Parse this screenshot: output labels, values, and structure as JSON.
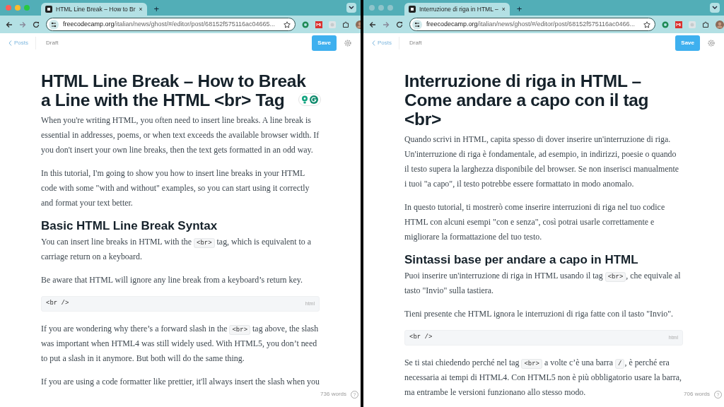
{
  "windows": [
    {
      "active": true,
      "tab": {
        "title": "HTML Line Break – How to Br",
        "close": "×"
      },
      "new_tab": "+",
      "url": {
        "host": "freecodecamp.org",
        "path": "/italian/news/ghost/#/editor/post/68152f575116ac04665..."
      },
      "editor": {
        "back_link": "Posts",
        "status": "Draft",
        "save": "Save",
        "title": "HTML Line Break – How to Break a Line with the HTML <br> Tag",
        "assistant_badge": true,
        "blocks": [
          {
            "kind": "paragraph",
            "parts": [
              {
                "kind": "text",
                "text": "When you're writing HTML, you often need to insert line breaks. A line break is essential in addresses, poems, or when text exceeds the available browser width. If you don't insert your own line breaks, then the text gets formatted in an odd way."
              }
            ]
          },
          {
            "kind": "paragraph",
            "parts": [
              {
                "kind": "text",
                "text": "In this tutorial, I'm going to show you how to insert line breaks in your HTML code with some \"with and without\" examples, so you can start using it correctly and format your text better."
              }
            ]
          },
          {
            "kind": "heading",
            "text": "Basic HTML Line Break Syntax"
          },
          {
            "kind": "paragraph",
            "parts": [
              {
                "kind": "text",
                "text": "You can insert line breaks in HTML with the "
              },
              {
                "kind": "code",
                "text": "<br>"
              },
              {
                "kind": "text",
                "text": " tag, which is equivalent to a carriage return on a keyboard."
              }
            ]
          },
          {
            "kind": "paragraph",
            "parts": [
              {
                "kind": "text",
                "text": "Be aware that HTML will ignore any line break from a keyboard’s return key."
              }
            ]
          },
          {
            "kind": "code_block",
            "code": "<br />",
            "language": "html"
          },
          {
            "kind": "paragraph",
            "parts": [
              {
                "kind": "text",
                "text": "If you are wondering why there’s a forward slash in the "
              },
              {
                "kind": "code",
                "text": "<br>"
              },
              {
                "kind": "text",
                "text": " tag above, the slash was important when HTML4 was still widely used. With HTML5, you don’t need to put a slash in it anymore. But both will do the same thing."
              }
            ]
          },
          {
            "kind": "paragraph",
            "parts": [
              {
                "kind": "text",
                "text": "If you are using a code formatter like prettier, it'll always insert the slash when you"
              }
            ]
          }
        ],
        "word_count": "736 words",
        "help": "?"
      }
    },
    {
      "active": false,
      "tab": {
        "title": "Interruzione di riga in HTML –",
        "close": "×"
      },
      "new_tab": "+",
      "url": {
        "host": "freecodecamp.org",
        "path": "/italian/news/ghost/#/editor/post/68152f575116ac0466..."
      },
      "editor": {
        "back_link": "Posts",
        "status": "Draft",
        "save": "Save",
        "title": "Interruzione di riga in HTML – Come andare a capo con il tag <br>",
        "assistant_badge": false,
        "blocks": [
          {
            "kind": "paragraph",
            "parts": [
              {
                "kind": "text",
                "text": "Quando scrivi in HTML, capita spesso di dover inserire un'interruzione di riga. Un'interruzione di riga è fondamentale, ad esempio, in indirizzi, poesie o quando il testo supera la larghezza disponibile del browser. Se non inserisci manualmente i tuoi \"a capo\", il testo potrebbe essere formattato in modo anomalo."
              }
            ]
          },
          {
            "kind": "paragraph",
            "parts": [
              {
                "kind": "text",
                "text": "In questo tutorial, ti mostrerò come inserire interruzioni di riga nel tuo codice HTML con alcuni esempi \"con e senza\", così potrai usarle correttamente e migliorare la formattazione del tuo testo."
              }
            ]
          },
          {
            "kind": "heading",
            "text": "Sintassi base per andare a capo in HTML"
          },
          {
            "kind": "paragraph",
            "parts": [
              {
                "kind": "text",
                "text": "Puoi inserire un'interruzione di riga in HTML usando il tag "
              },
              {
                "kind": "code",
                "text": "<br>"
              },
              {
                "kind": "text",
                "text": ", che equivale al tasto \"Invio\" sulla tastiera."
              }
            ]
          },
          {
            "kind": "paragraph",
            "parts": [
              {
                "kind": "text",
                "text": "Tieni presente che HTML ignora le interruzioni di riga fatte con il tasto \"Invio\"."
              }
            ]
          },
          {
            "kind": "code_block",
            "code": "<br />",
            "language": "html"
          },
          {
            "kind": "paragraph",
            "parts": [
              {
                "kind": "text",
                "text": "Se ti stai chiedendo perché nel tag "
              },
              {
                "kind": "code",
                "text": "<br>"
              },
              {
                "kind": "text",
                "text": " a volte c’è una barra "
              },
              {
                "kind": "code",
                "text": "/"
              },
              {
                "kind": "text",
                "text": ", è perché era necessaria ai tempi di HTML4. Con HTML5 non è più obbligatorio usare la barra, ma entrambe le versioni funzionano allo stesso modo."
              }
            ]
          }
        ],
        "word_count": "706 words",
        "help": "?"
      }
    }
  ]
}
